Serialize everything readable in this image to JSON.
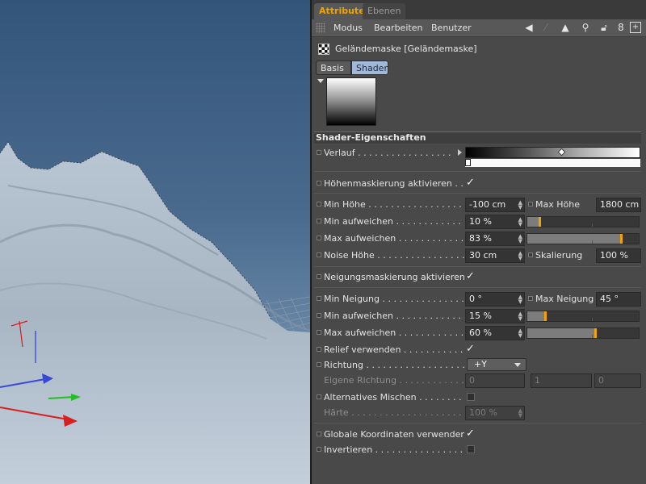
{
  "tabs": {
    "attribute": "Attribute",
    "ebenen": "Ebenen"
  },
  "menu": {
    "modus": "Modus",
    "bearbeiten": "Bearbeiten",
    "benutzer": "Benutzer"
  },
  "toolbar_icons": [
    "arrow-left-icon",
    "arrow-up-icon",
    "search-icon",
    "lock-icon",
    "object-icon",
    "add-panel-icon"
  ],
  "object": {
    "title": "Geländemaske [Geländemaske]",
    "icon": "checker-icon"
  },
  "subtabs": {
    "basis": "Basis",
    "shader": "Shader"
  },
  "section_title": "Shader-Eigenschaften",
  "verlauf": {
    "label": "Verlauf . . . . . . . . . . . . . . . . . . ."
  },
  "hoehen": {
    "activate_label": "Höhenmaskierung aktivieren . . .",
    "activate": true,
    "min_hoehe_label": "Min Höhe . . . . . . . . . . . . . . . . . . .",
    "min_hoehe": "-100 cm",
    "max_hoehe_label": "Max Höhe",
    "max_hoehe": "1800 cm",
    "min_aufweichen_label": "Min aufweichen . . . . . . . . . . . . . . .",
    "min_aufweichen": "10 %",
    "min_aufweichen_value": 0.1,
    "max_aufweichen_label": "Max aufweichen . . . . . . . . . . . . . . .",
    "max_aufweichen": "83 %",
    "max_aufweichen_value": 0.83,
    "noise_label": "Noise Höhe . . . . . . . . . . . . . . . . . .",
    "noise": "30 cm",
    "skalierung_label": "Skalierung",
    "skalierung": "100 %"
  },
  "neigung": {
    "activate_label": "Neigungsmaskierung aktivieren",
    "activate": true,
    "min_neigung_label": "Min Neigung . . . . . . . . . . . . . . . . .",
    "min_neigung": "0 °",
    "max_neigung_label": "Max Neigung",
    "max_neigung": "45 °",
    "min_aufweichen_label": "Min aufweichen . . . . . . . . . . . . . . .",
    "min_aufweichen": "15 %",
    "min_aufweichen_value": 0.15,
    "max_aufweichen_label": "Max aufweichen . . . . . . . . . . . . . . .",
    "max_aufweichen": "60 %",
    "max_aufweichen_value": 0.6,
    "relief_label": "Relief verwenden . . . . . . . . . . . . . . .",
    "relief": true,
    "richtung_label": "Richtung . . . . . . . . . . . . . . . . . . . .",
    "richtung": "+Y",
    "eigene_label": "Eigene Richtung . . . . . . . . . . . . . . .",
    "eigene_x": "0",
    "eigene_y": "1",
    "eigene_z": "0",
    "alt_mischen_label": "Alternatives Mischen . . . . . . . . . .",
    "alt_mischen": false,
    "haerte_label": "Härte . . . . . . . . . . . . . . . . . . . . . .",
    "haerte": "100 %"
  },
  "global": {
    "coords_label": "Globale Koordinaten verwenden",
    "coords": true,
    "invert_label": "Invertieren . . . . . . . . . . . . . . . . . . .",
    "invert": false
  },
  "colors": {
    "accent": "#f0a400",
    "panel": "#494949",
    "shader_tab": "#a2b8d8"
  }
}
